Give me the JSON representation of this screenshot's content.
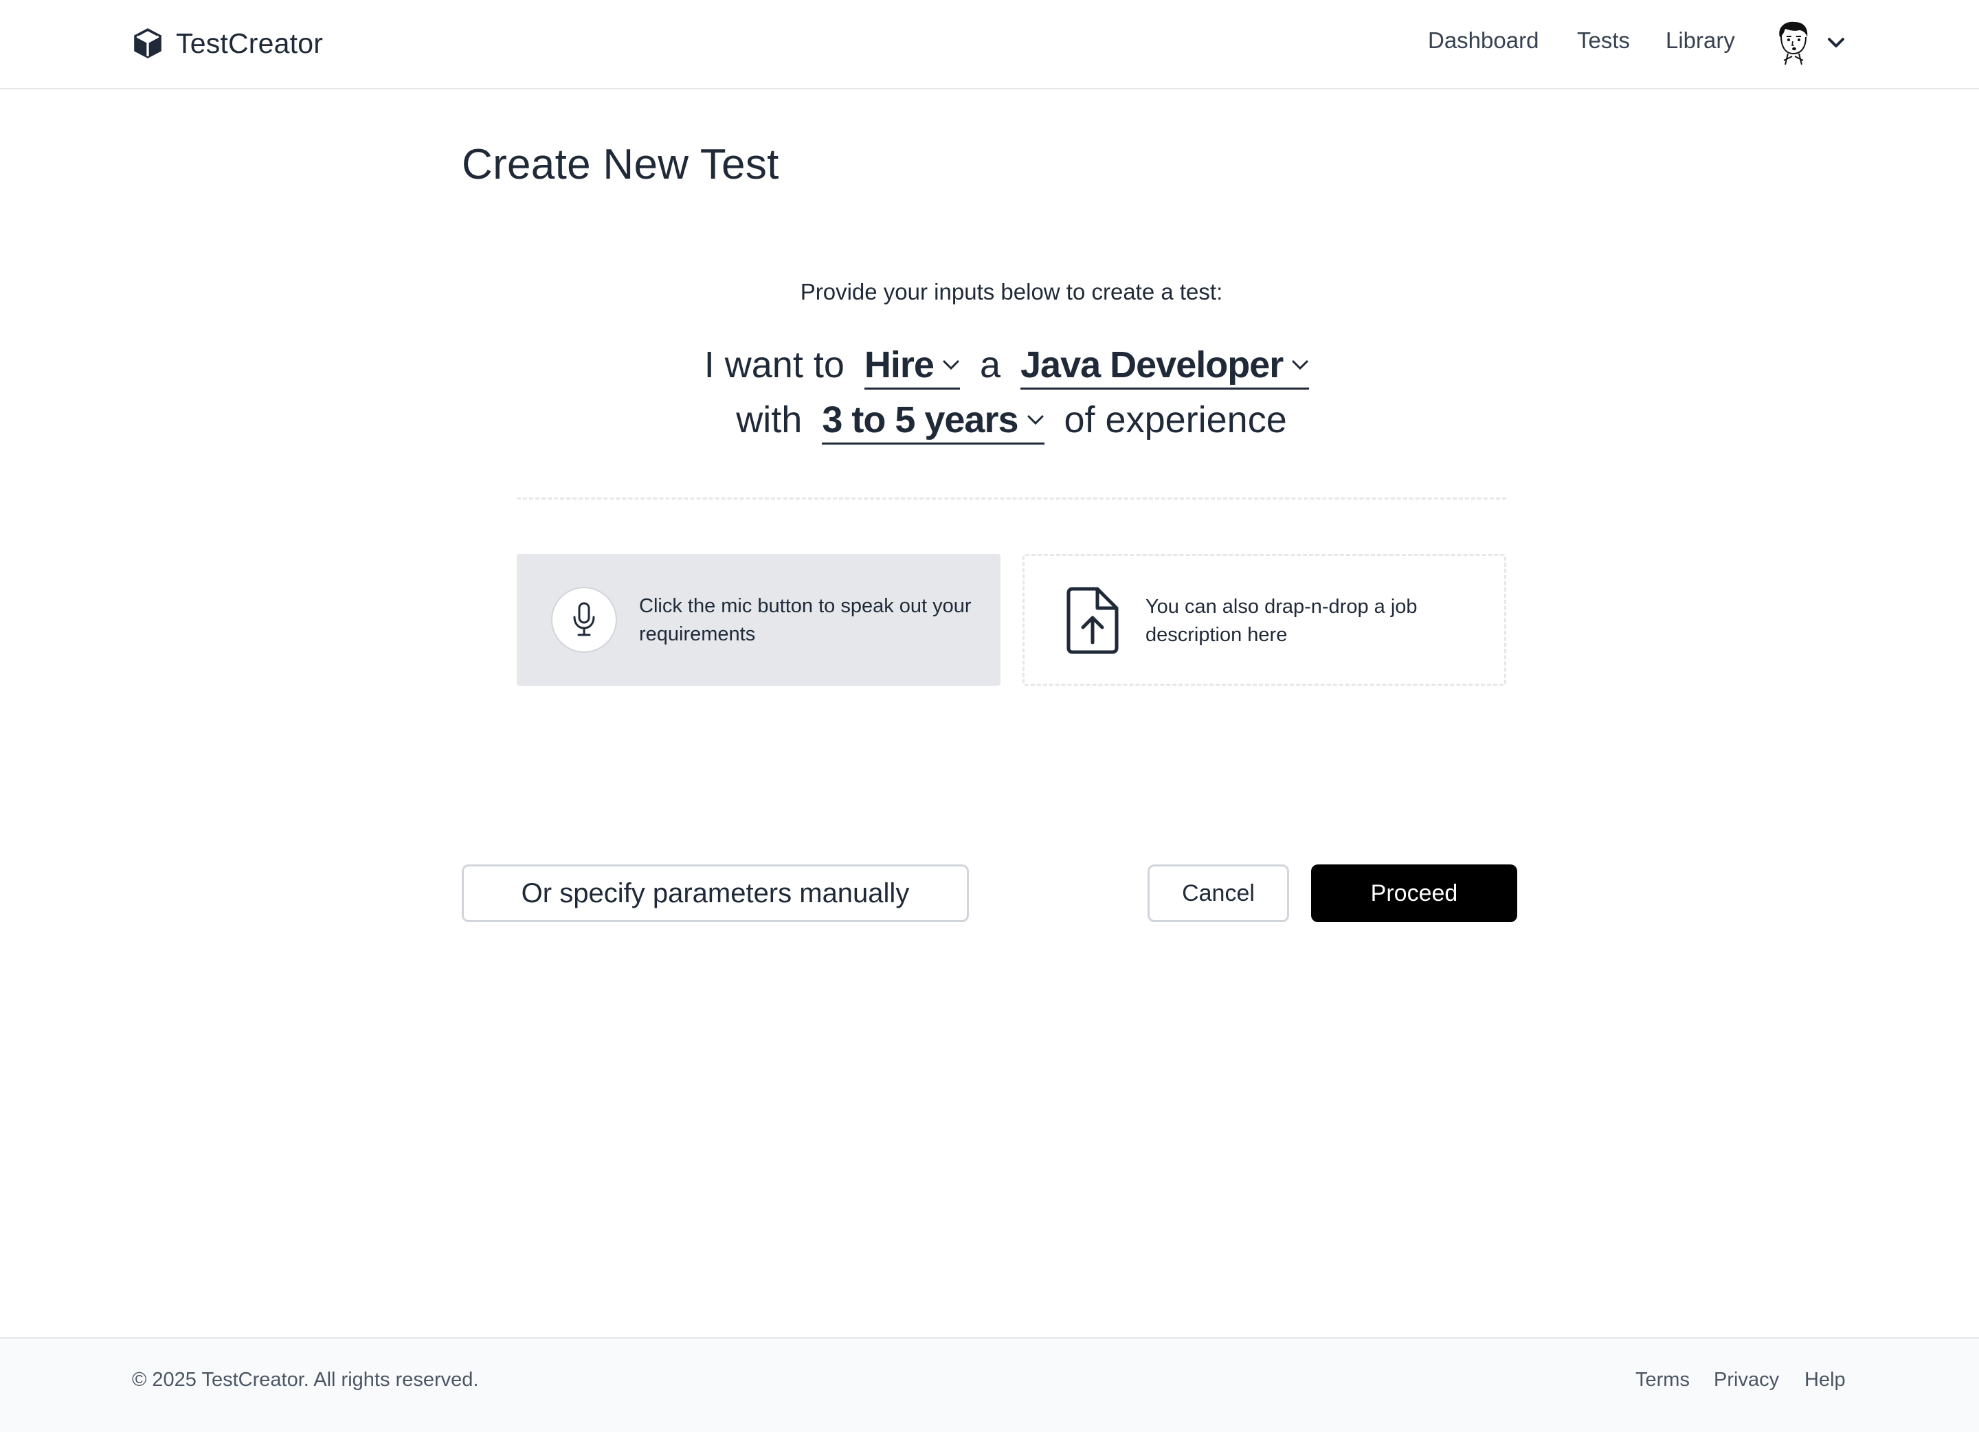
{
  "brand": {
    "name": "TestCreator",
    "logo_icon": "cube-icon"
  },
  "nav": {
    "items": [
      "Dashboard",
      "Tests",
      "Library"
    ],
    "avatar_icon": "avatar-icon",
    "menu_icon": "chevron-down-icon"
  },
  "main": {
    "title": "Create New Test",
    "subtitle": "Provide your inputs below to create a test:",
    "sentence": {
      "prefix": "I want to",
      "action": "Hire",
      "joiner": "a",
      "role": "Java Developer",
      "with": "with",
      "experience": "3 to 5 years",
      "suffix": "of experience"
    },
    "mic_card": {
      "icon": "microphone-icon",
      "text": "Click the mic button to speak out your requirements"
    },
    "drop_card": {
      "icon": "file-upload-icon",
      "text": "You can also drap-n-drop a job description here"
    },
    "buttons": {
      "manual": "Or specify parameters manually",
      "cancel": "Cancel",
      "proceed": "Proceed"
    }
  },
  "footer": {
    "copyright": "© 2025 TestCreator. All rights reserved.",
    "links": [
      "Terms",
      "Privacy",
      "Help"
    ]
  },
  "colors": {
    "text": "#1f2937",
    "primary_button": "#000000",
    "card_bg": "#e5e7eb",
    "footer_bg": "#f9fafb"
  }
}
